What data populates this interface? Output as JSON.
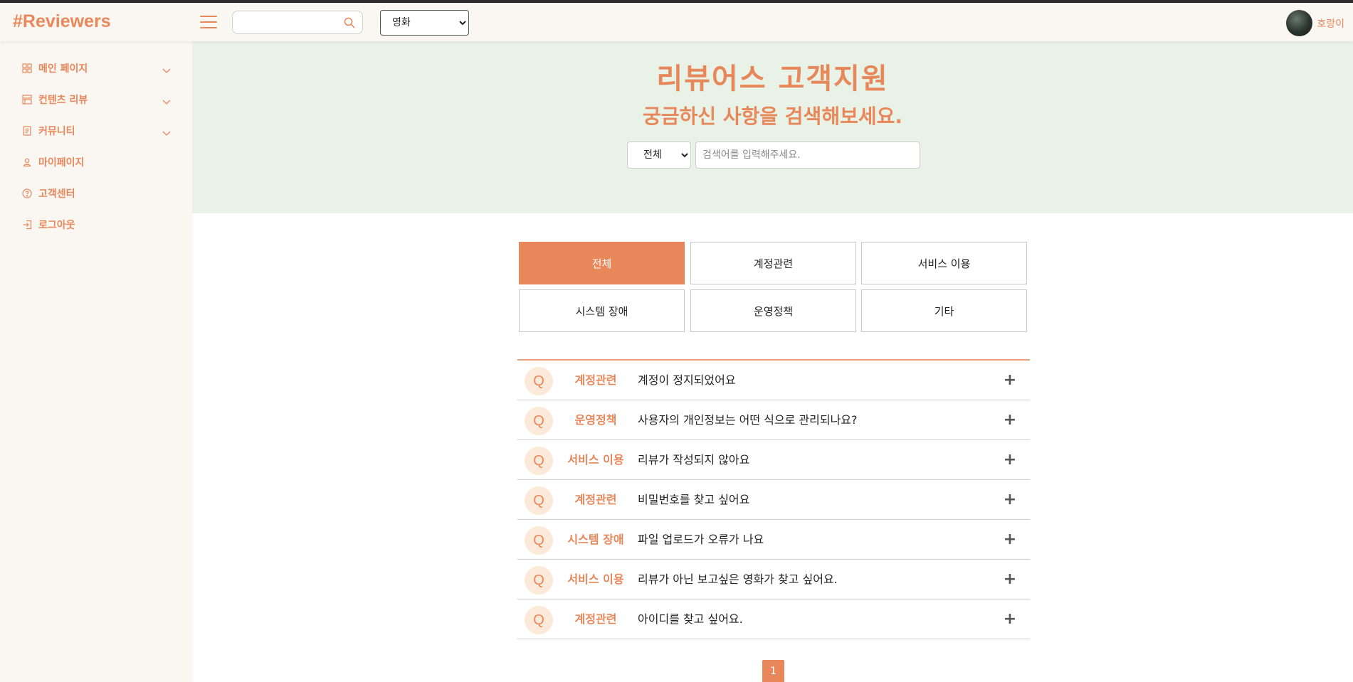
{
  "app": {
    "logo": "#Reviewers"
  },
  "header": {
    "search": {
      "value": "",
      "placeholder": ""
    },
    "category_select": {
      "selected": "영화",
      "options": [
        "영화"
      ]
    },
    "user": {
      "name": "호랑이"
    }
  },
  "sidebar": {
    "items": [
      {
        "label": "메인 페이지",
        "icon": "grid-icon",
        "expandable": true
      },
      {
        "label": "컨텐츠 리뷰",
        "icon": "list-icon",
        "expandable": true
      },
      {
        "label": "커뮤니티",
        "icon": "document-icon",
        "expandable": true
      },
      {
        "label": "마이페이지",
        "icon": "user-icon",
        "expandable": false
      },
      {
        "label": "고객센터",
        "icon": "help-icon",
        "expandable": false
      },
      {
        "label": "로그아웃",
        "icon": "logout-icon",
        "expandable": false
      }
    ]
  },
  "banner": {
    "title": "리뷰어스 고객지원",
    "subtitle": "궁금하신 사항을 검색해보세요.",
    "filter": {
      "selected": "전체",
      "options": [
        "전체"
      ]
    },
    "search": {
      "value": "",
      "placeholder": "검색어를 입력해주세요."
    }
  },
  "categories": [
    {
      "label": "전체",
      "active": true
    },
    {
      "label": "계정관련",
      "active": false
    },
    {
      "label": "서비스 이용",
      "active": false
    },
    {
      "label": "시스템 장애",
      "active": false
    },
    {
      "label": "운영정책",
      "active": false
    },
    {
      "label": "기타",
      "active": false
    }
  ],
  "faq": {
    "q_marker": "Q",
    "expand_symbol": "+",
    "rows": [
      {
        "category": "계정관련",
        "question": "계정이 정지되었어요"
      },
      {
        "category": "운영정책",
        "question": "사용자의 개인정보는 어떤 식으로 관리되나요?"
      },
      {
        "category": "서비스 이용",
        "question": "리뷰가 작성되지 않아요"
      },
      {
        "category": "계정관련",
        "question": "비밀번호를 찾고 싶어요"
      },
      {
        "category": "시스템 장애",
        "question": "파일 업로드가 오류가 나요"
      },
      {
        "category": "서비스 이용",
        "question": "리뷰가 아닌 보고싶은 영화가 찾고 싶어요."
      },
      {
        "category": "계정관련",
        "question": "아이디를 찾고 싶어요."
      }
    ]
  },
  "pagination": {
    "current": "1"
  },
  "colors": {
    "accent": "#e8875a",
    "banner_bg": "#e8f2e6",
    "sidebar_bg": "#faf6f2",
    "q_circle": "#fbe9da"
  }
}
